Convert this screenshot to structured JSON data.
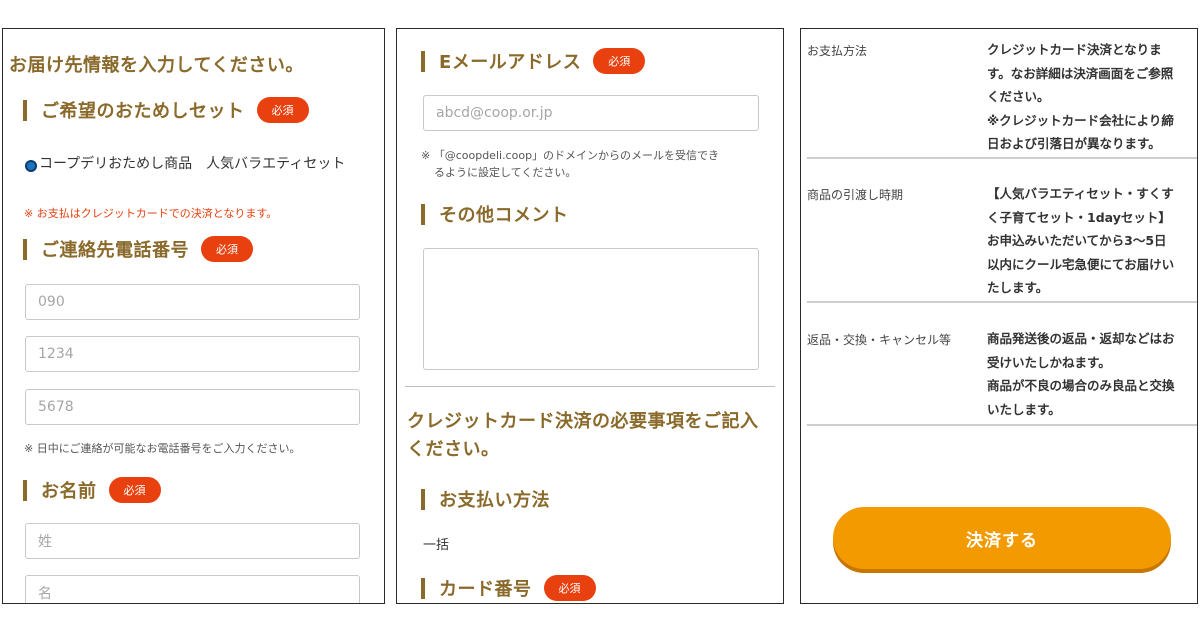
{
  "panel1": {
    "heading": "お届け先情報を入力してください。",
    "set_section": {
      "title": "ご希望のおためしセット",
      "required": "必須"
    },
    "set_option": "コープデリおためし商品　人気バラエティセット",
    "payment_note": "※ お支払はクレジットカードでの決済となります。",
    "phone_section": {
      "title": "ご連絡先電話番号",
      "required": "必須"
    },
    "phone_placeholders": [
      "090",
      "1234",
      "5678"
    ],
    "phone_note": "※ 日中にご連絡が可能なお電話番号をご入力ください。",
    "name_section": {
      "title": "お名前",
      "required": "必須"
    },
    "name_placeholders": {
      "last": "姓",
      "first": "名"
    }
  },
  "panel2": {
    "email_section": {
      "title": "Eメールアドレス",
      "required": "必須"
    },
    "email_placeholder": "abcd@coop.or.jp",
    "email_note_1": "※ 「@coopdeli.coop」のドメインからのメールを受信でき",
    "email_note_2": "るように設定してください。",
    "comment_section": {
      "title": "その他コメント"
    },
    "card_heading_1": "クレジットカード決済の必要事項をご記入",
    "card_heading_2": "ください。",
    "pay_method_section": {
      "title": "お支払い方法"
    },
    "pay_method_value": "一括",
    "card_number_section": {
      "title": "カード番号",
      "required": "必須"
    }
  },
  "panel3": {
    "rows": [
      {
        "label": "お支払方法",
        "lines": [
          "クレジットカード決済となりま",
          "す。なお詳細は決済画面をご参照",
          "ください。",
          "※クレジットカード会社により締",
          "日および引落日が異なります。"
        ]
      },
      {
        "label": "商品の引渡し時期",
        "lines": [
          "【人気バラエティセット・すくす",
          "く子育てセット・1dayセット】",
          "お申込みいただいてから3〜5日",
          "以内にクール宅急便にてお届けい",
          "たします。"
        ]
      },
      {
        "label": "返品・交換・キャンセル等",
        "lines": [
          "商品発送後の返品・返却などはお",
          "受けいたしかねます。",
          "商品が不良の場合のみ良品と交換",
          "いたします。"
        ]
      }
    ],
    "pay_button": "決済する"
  },
  "colors": {
    "brand": "#8a6a2b",
    "required_badge": "#e8410f",
    "pay_button": "#f29a00",
    "radio": "#1e73be"
  }
}
